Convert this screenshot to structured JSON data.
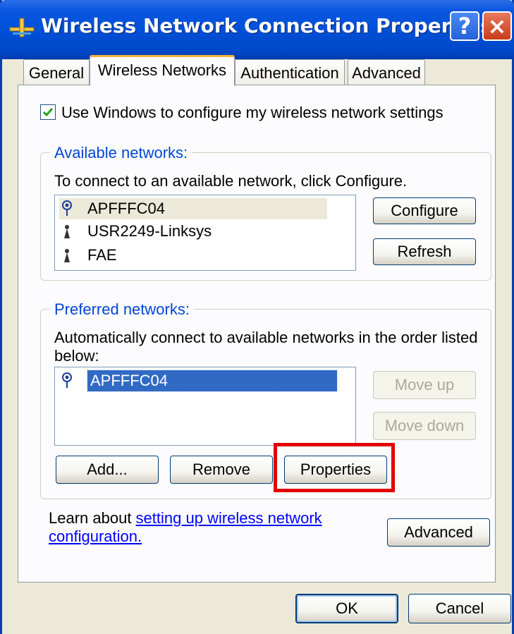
{
  "window": {
    "title": "Wireless Network Connection Properties",
    "help_label": "?",
    "close_label": "×"
  },
  "tabs": [
    {
      "label": "General",
      "active": false
    },
    {
      "label": "Wireless Networks",
      "active": true
    },
    {
      "label": "Authentication",
      "active": false
    },
    {
      "label": "Advanced",
      "active": false
    }
  ],
  "use_windows": {
    "checked": true,
    "label": "Use Windows to configure my wireless network settings"
  },
  "available": {
    "legend": "Available networks:",
    "instructions": "To connect to an available network, click Configure.",
    "networks": [
      {
        "name": "APFFFC04",
        "icon": "wireless-preferred-icon",
        "selected": true
      },
      {
        "name": "USR2249-Linksys",
        "icon": "wireless-antenna-icon",
        "selected": false
      },
      {
        "name": "FAE",
        "icon": "wireless-antenna-icon",
        "selected": false
      }
    ],
    "configure_label": "Configure",
    "refresh_label": "Refresh"
  },
  "preferred": {
    "legend": "Preferred networks:",
    "instructions_line1": "Automatically connect to available networks in the order listed",
    "instructions_line2": "below:",
    "networks": [
      {
        "name": "APFFFC04",
        "icon": "wireless-preferred-icon",
        "selected": true
      }
    ],
    "move_up_label": "Move up",
    "move_down_label": "Move down",
    "add_label": "Add...",
    "remove_label": "Remove",
    "properties_label": "Properties"
  },
  "learn": {
    "prefix": "Learn about ",
    "link_line1": "setting up wireless network",
    "link_line2": "configuration."
  },
  "advanced_label": "Advanced",
  "ok_label": "OK",
  "cancel_label": "Cancel",
  "colors": {
    "titlebar": "#0050d8",
    "highlight": "#e00000",
    "legend": "#0046d5",
    "selection": "#316ac5"
  }
}
